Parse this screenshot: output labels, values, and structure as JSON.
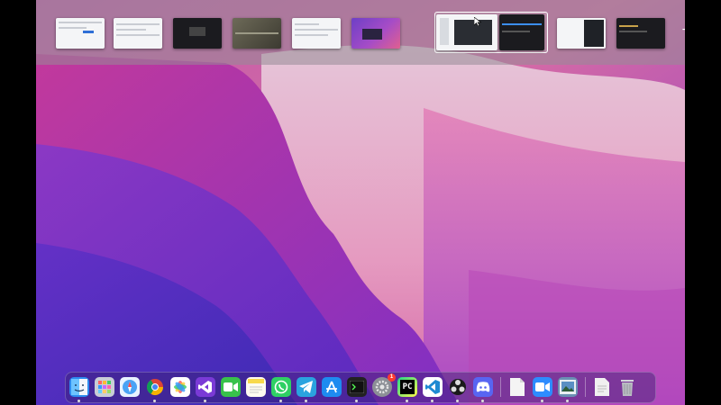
{
  "spaces": {
    "thumbnails": [
      {
        "style": "light",
        "icon": "browser-window"
      },
      {
        "style": "light",
        "icon": "document-window"
      },
      {
        "style": "dark",
        "icon": "media-player-window"
      },
      {
        "style": "photo",
        "icon": "photo-window"
      },
      {
        "style": "light",
        "icon": "web-page-window"
      },
      {
        "style": "purple",
        "icon": "desktop-space"
      },
      {
        "style": "light",
        "icon": "split-editor-window",
        "active": true
      },
      {
        "style": "dark",
        "icon": "terminal-editor-window",
        "active": true
      },
      {
        "style": "light",
        "icon": "code-editor-window"
      },
      {
        "style": "dark",
        "icon": "terminal-window"
      }
    ],
    "add_space_icon": "plus-icon"
  },
  "dock": {
    "apps": [
      {
        "name": "finder",
        "icon": "finder-icon",
        "color": "#2d8cf0"
      },
      {
        "name": "launchpad",
        "icon": "launchpad-icon",
        "color": "#c9cdd6"
      },
      {
        "name": "safari",
        "icon": "safari-icon",
        "color": "#4aa3f5"
      },
      {
        "name": "chrome",
        "icon": "chrome-icon",
        "color": "#ffffff"
      },
      {
        "name": "photos",
        "icon": "photos-icon",
        "color": "#ffffff"
      },
      {
        "name": "visual-studio",
        "icon": "visual-studio-icon",
        "color": "#7a3ad6"
      },
      {
        "name": "facetime",
        "icon": "facetime-icon",
        "color": "#38c24b"
      },
      {
        "name": "notes",
        "icon": "notes-icon",
        "color": "#f7e37a"
      },
      {
        "name": "whatsapp",
        "icon": "whatsapp-icon",
        "color": "#2fd064"
      },
      {
        "name": "telegram",
        "icon": "telegram-icon",
        "color": "#2aa3df"
      },
      {
        "name": "app-store",
        "icon": "app-store-icon",
        "color": "#1e8bf0"
      },
      {
        "name": "terminal",
        "icon": "terminal-icon",
        "color": "#222222"
      },
      {
        "name": "system-preferences",
        "icon": "gear-icon",
        "color": "#8c8f96",
        "badge": "1"
      },
      {
        "name": "pycharm",
        "icon": "pycharm-icon",
        "color": "#1c1c1c",
        "label": "PC"
      },
      {
        "name": "vscode",
        "icon": "vscode-icon",
        "color": "#ffffff"
      },
      {
        "name": "obs",
        "icon": "obs-icon",
        "color": "#2b2b2b"
      },
      {
        "name": "discord",
        "icon": "discord-icon",
        "color": "#5865f2"
      },
      {
        "name": "textedit",
        "icon": "document-icon",
        "color": "#f4f4f4"
      },
      {
        "name": "zoom",
        "icon": "zoom-icon",
        "color": "#2d8cff"
      },
      {
        "name": "preview",
        "icon": "preview-icon",
        "color": "#6a8fb3"
      },
      {
        "name": "downloads",
        "icon": "file-icon",
        "color": "#f0f0f0"
      },
      {
        "name": "trash",
        "icon": "trash-icon",
        "color": "#b9bcc2"
      }
    ]
  }
}
